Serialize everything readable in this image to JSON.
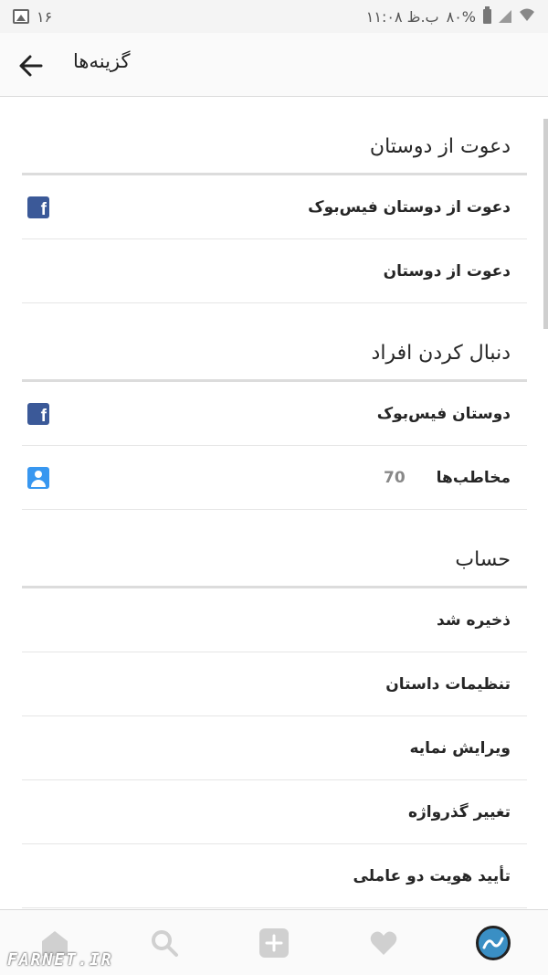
{
  "status_bar": {
    "notification_count": "۱۶",
    "time": "۱۱:۰۸ ب.ظ",
    "battery": "۸۰%"
  },
  "app_bar": {
    "title": "گزینه‌ها"
  },
  "sections": [
    {
      "header": "دعوت از دوستان",
      "rows": [
        {
          "label": "دعوت از دوستان فیس‌بوک",
          "icon": "facebook-icon"
        },
        {
          "label": "دعوت از دوستان"
        }
      ]
    },
    {
      "header": "دنبال کردن افراد",
      "rows": [
        {
          "label": "دوستان فیس‌بوک",
          "icon": "facebook-icon"
        },
        {
          "label": "مخاطب‌ها",
          "count": "70",
          "icon": "contact-icon"
        }
      ]
    },
    {
      "header": "حساب",
      "rows": [
        {
          "label": "ذخیره شد"
        },
        {
          "label": "تنظیمات داستان"
        },
        {
          "label": "ویرایش نمایه"
        },
        {
          "label": "تغییر گذرواژه"
        },
        {
          "label": "تأیید هویت دو عاملی"
        }
      ]
    }
  ],
  "bottom_nav": {
    "items": [
      "home-icon",
      "search-icon",
      "add-icon",
      "heart-icon",
      "profile-avatar"
    ]
  },
  "colors": {
    "facebook": "#3b5998",
    "contact": "#3897f0",
    "nav_icon": "#d0d0d0"
  },
  "watermark": "FARNET.IR"
}
